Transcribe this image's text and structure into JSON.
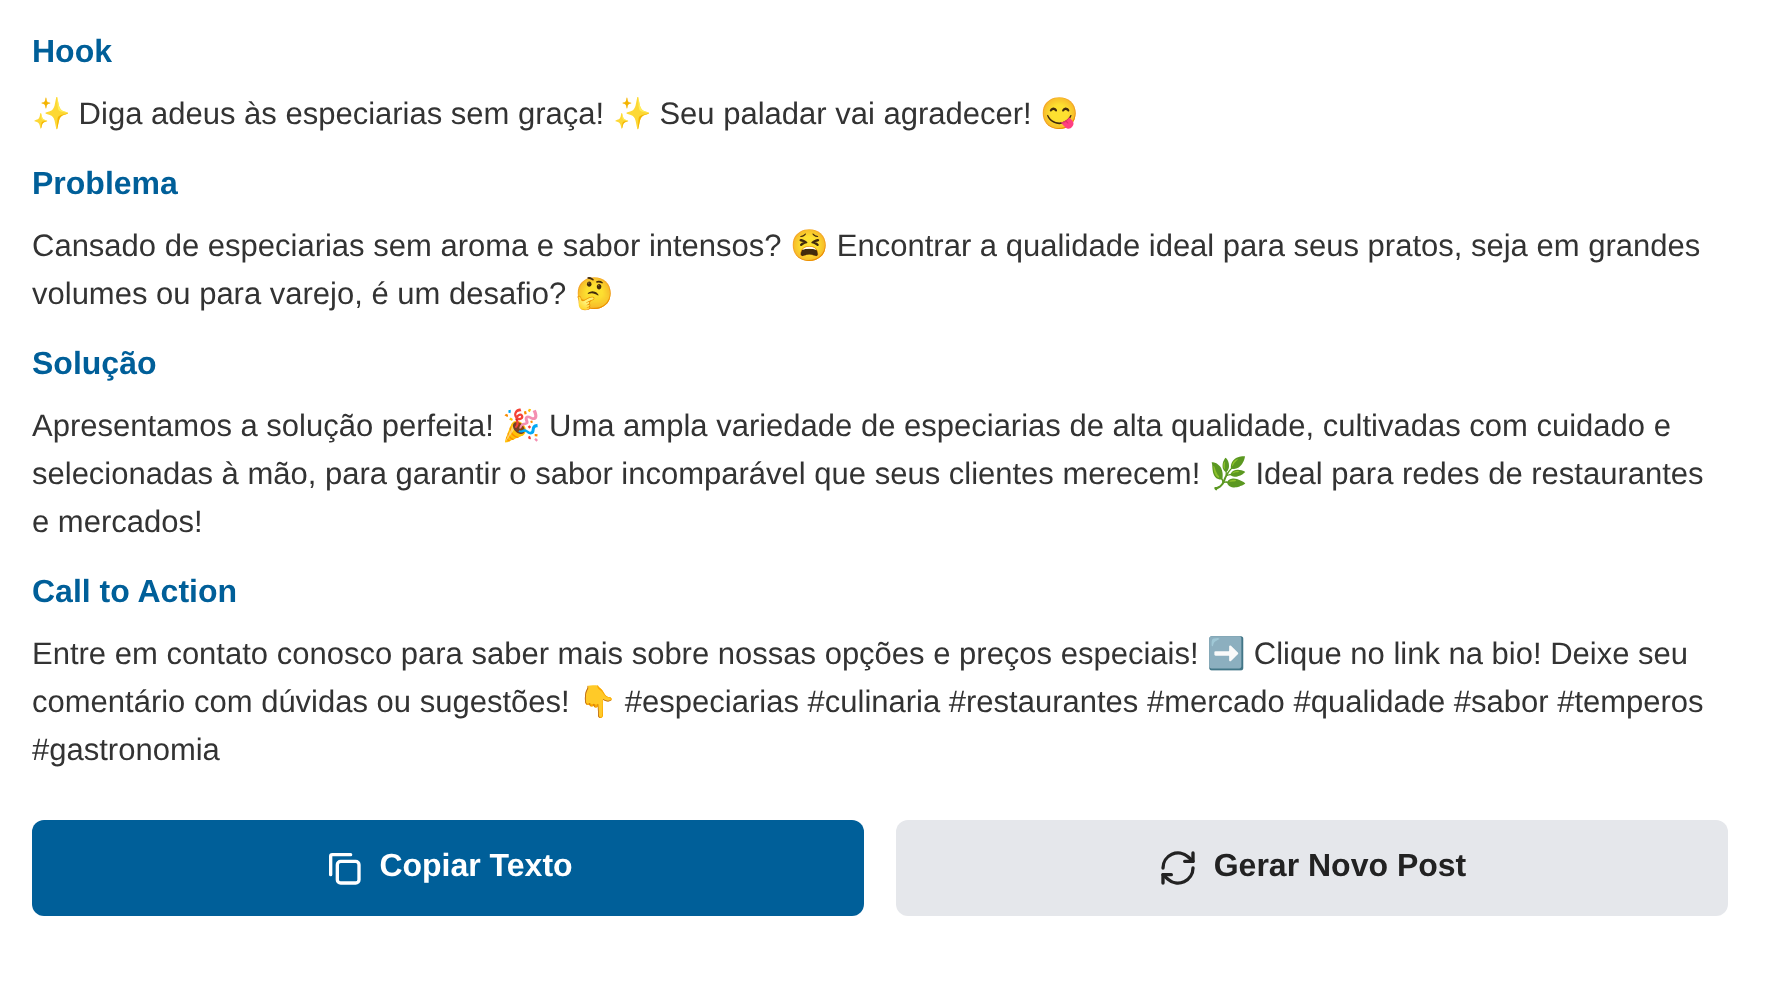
{
  "sections": [
    {
      "title": "Hook",
      "text": "✨ Diga adeus às especiarias sem graça! ✨ Seu paladar vai agradecer! 😋"
    },
    {
      "title": "Problema",
      "text": "Cansado de especiarias sem aroma e sabor intensos? 😫 Encontrar a qualidade ideal para seus pratos, seja em grandes volumes ou para varejo, é um desafio? 🤔"
    },
    {
      "title": "Solução",
      "text": "Apresentamos a solução perfeita! 🎉 Uma ampla variedade de especiarias de alta qualidade, cultivadas com cuidado e selecionadas à mão, para garantir o sabor incomparável que seus clientes merecem! 🌿 Ideal para redes de restaurantes e mercados!"
    },
    {
      "title": "Call to Action",
      "text": "Entre em contato conosco para saber mais sobre nossas opções e preços especiais! ➡️ Clique no link na bio! Deixe seu comentário com dúvidas ou sugestões! 👇 #especiarias #culinaria #restaurantes #mercado #qualidade #sabor #temperos #gastronomia"
    }
  ],
  "buttons": [
    {
      "kind": "copy",
      "label": "Copiar Texto"
    },
    {
      "kind": "refresh",
      "label": "Gerar Novo Post"
    }
  ]
}
